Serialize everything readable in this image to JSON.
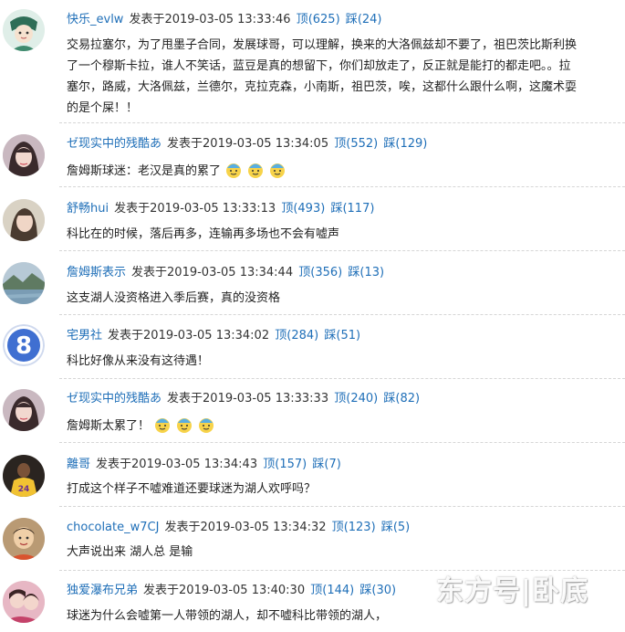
{
  "posted_label": "发表于",
  "up_label": "顶",
  "down_label": "踩",
  "comments": [
    {
      "user": "快乐_evlw",
      "time": "2019-03-05 13:33:46",
      "up": "(625)",
      "down": "(24)",
      "lines": [
        "交易拉塞尔，为了甩墨子合同，发展球哥，可以理解，换来的大洛佩兹却不要了，祖巴茨比斯利换",
        "了一个穆斯卡拉，谁人不笑话，蓝豆是真的想留下，你们却放走了，反正就是能打的都走吧。。拉",
        "塞尔，路威，大洛佩兹，兰德尔，克拉克森，小南斯，祖巴茨，唉，这都什么跟什么啊，这魔术耍",
        "的是个屎！！"
      ],
      "avatar_icon": "cartoon-avatar-icon"
    },
    {
      "user": "ゼ现实中的残酷あ",
      "time": "2019-03-05 13:34:05",
      "up": "(552)",
      "down": "(129)",
      "lines": [
        "詹姆斯球迷：老汉是真的累了"
      ],
      "emoji": 3,
      "avatar_icon": "girl-photo-avatar"
    },
    {
      "user": "舒畅hui",
      "time": "2019-03-05 13:33:13",
      "up": "(493)",
      "down": "(117)",
      "lines": [
        "科比在的时候，落后再多，连输再多场也不会有嘘声"
      ],
      "avatar_icon": "woman-photo-avatar"
    },
    {
      "user": "詹姆斯表示",
      "time": "2019-03-05 13:34:44",
      "up": "(356)",
      "down": "(13)",
      "lines": [
        "这支湖人没资格进入季后赛，真的没资格"
      ],
      "avatar_icon": "landscape-avatar"
    },
    {
      "user": "宅男社",
      "time": "2019-03-05 13:34:02",
      "up": "(284)",
      "down": "(51)",
      "lines": [
        "科比好像从来没有这待遇！"
      ],
      "avatar_icon": "number-8-avatar"
    },
    {
      "user": "ゼ现实中的残酷あ",
      "time": "2019-03-05 13:33:33",
      "up": "(240)",
      "down": "(82)",
      "lines": [
        "詹姆斯太累了！"
      ],
      "emoji": 3,
      "avatar_icon": "girl-photo-avatar"
    },
    {
      "user": "離哥",
      "time": "2019-03-05 13:34:43",
      "up": "(157)",
      "down": "(7)",
      "lines": [
        "打成这个样子不嘘难道还要球迷为湖人欢呼吗？"
      ],
      "avatar_icon": "player-photo-avatar"
    },
    {
      "user": "chocolate_w7CJ",
      "time": "2019-03-05 13:34:32",
      "up": "(123)",
      "down": "(5)",
      "lines": [
        "大声说出来 湖人总 是输"
      ],
      "avatar_icon": "child-photo-avatar"
    },
    {
      "user": "独爱瀑布兄弟",
      "time": "2019-03-05 13:40:30",
      "up": "(144)",
      "down": "(30)",
      "lines": [
        "球迷为什么会嘘第一人带领的湖人，却不嘘科比带领的湖人，"
      ],
      "avatar_icon": "couple-photo-avatar"
    }
  ],
  "watermark": "东方号|卧底",
  "colors": {
    "link": "#1f6fb8",
    "text": "#222222",
    "divider": "#d6d6d6"
  }
}
